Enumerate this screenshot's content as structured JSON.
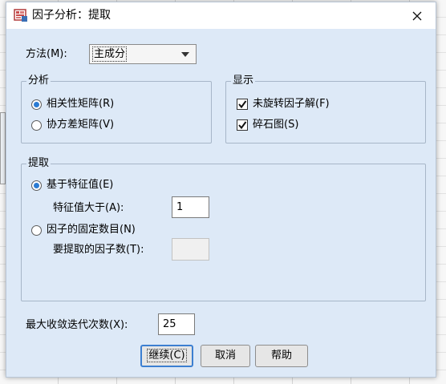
{
  "window": {
    "title": "因子分析：提取",
    "close_glyph": "✕"
  },
  "method": {
    "label": "方法(M):",
    "selected": "主成分"
  },
  "analysis": {
    "title": "分析",
    "options": [
      {
        "label": "相关性矩阵(R)",
        "selected": true
      },
      {
        "label": "协方差矩阵(V)",
        "selected": false
      }
    ]
  },
  "display": {
    "title": "显示",
    "options": [
      {
        "label": "未旋转因子解(F)",
        "checked": true
      },
      {
        "label": "碎石图(S)",
        "checked": true
      }
    ]
  },
  "extract": {
    "title": "提取",
    "based_on_eigen": {
      "label": "基于特征值(E)",
      "selected": true
    },
    "eigen_greater_label": "特征值大于(A):",
    "eigen_value": "1",
    "fixed_factors": {
      "label": "因子的固定数目(N)",
      "selected": false
    },
    "num_factors_label": "要提取的因子数(T):",
    "num_factors_value": ""
  },
  "max_iterations": {
    "label": "最大收敛迭代次数(X):",
    "value": "25"
  },
  "buttons": {
    "continue": "继续(C)",
    "cancel": "取消",
    "help": "帮助"
  }
}
